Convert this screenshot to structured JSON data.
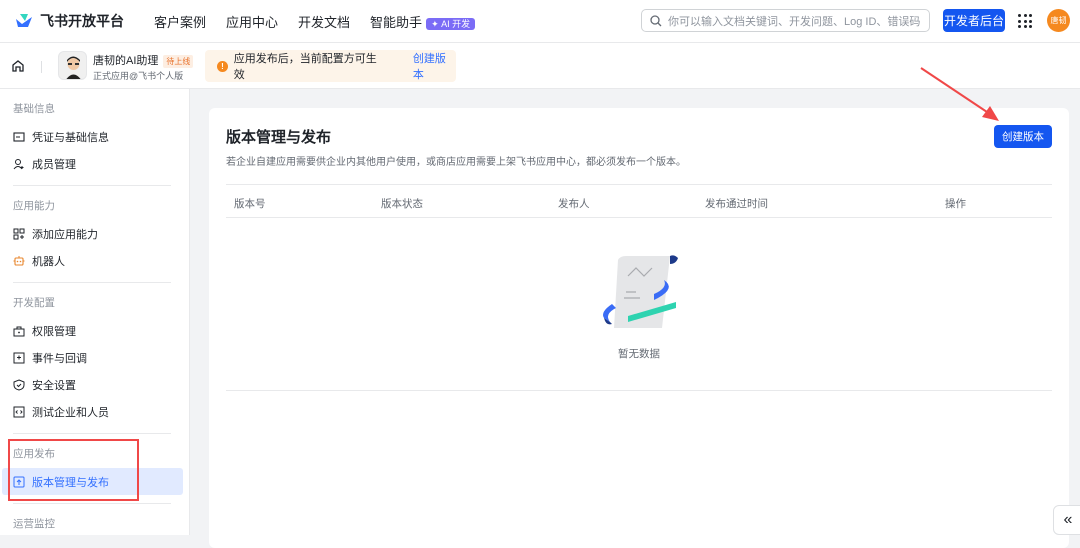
{
  "topbar": {
    "brand": "飞书开放平台",
    "nav": [
      "客户案例",
      "应用中心",
      "开发文档",
      "智能助手"
    ],
    "ai_badge": "AI 开发",
    "search_placeholder": "你可以输入文档关键词、开发问题、Log ID、错误码",
    "dev_console": "开发者后台",
    "avatar_text": "唐韧"
  },
  "subheader": {
    "app_name": "唐韧的AI助理",
    "app_badge": "待上线",
    "app_subtitle": "正式应用@飞书个人版",
    "notice": "应用发布后，当前配置方可生效",
    "notice_link": "创建版本"
  },
  "sidebar": {
    "groups": [
      {
        "label": "基础信息",
        "items": [
          {
            "label": "凭证与基础信息",
            "icon": "id-card-icon"
          },
          {
            "label": "成员管理",
            "icon": "user-add-icon"
          }
        ]
      },
      {
        "label": "应用能力",
        "items": [
          {
            "label": "添加应用能力",
            "icon": "apps-add-icon"
          },
          {
            "label": "机器人",
            "icon": "robot-icon"
          }
        ]
      },
      {
        "label": "开发配置",
        "items": [
          {
            "label": "权限管理",
            "icon": "lock-icon"
          },
          {
            "label": "事件与回调",
            "icon": "event-icon"
          },
          {
            "label": "安全设置",
            "icon": "shield-icon"
          },
          {
            "label": "测试企业和人员",
            "icon": "code-icon"
          }
        ]
      },
      {
        "label": "应用发布",
        "items": [
          {
            "label": "版本管理与发布",
            "icon": "upload-icon",
            "active": true
          }
        ]
      },
      {
        "label": "运营监控",
        "items": []
      }
    ]
  },
  "main": {
    "title": "版本管理与发布",
    "description": "若企业自建应用需要供企业内其他用户使用，或商店应用需要上架飞书应用中心，都必须发布一个版本。",
    "create_button": "创建版本",
    "columns": [
      "版本号",
      "版本状态",
      "发布人",
      "发布通过时间",
      "操作"
    ],
    "empty_text": "暂无数据"
  },
  "colors": {
    "primary": "#1456f0",
    "accent": "#3370ff",
    "warning": "#f5891f",
    "annotation": "#f04848"
  }
}
